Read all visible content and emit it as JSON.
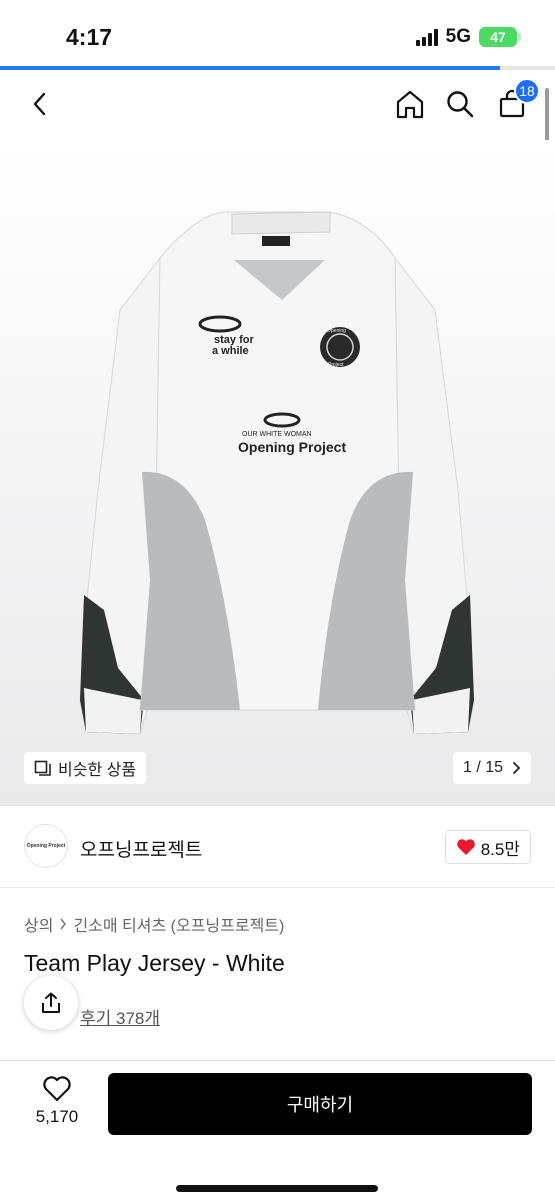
{
  "status_bar": {
    "time": "4:17",
    "network": "5G",
    "battery": "47"
  },
  "page_progress": 0.9,
  "header": {
    "cart_count": "18"
  },
  "gallery": {
    "similar_label": "비슷한 상품",
    "page_indicator": "1 / 15",
    "image_texts": {
      "chest_slogan_line1": "stay for",
      "chest_slogan_line2": "a while",
      "center_print": "Opening Project",
      "center_print_small": "OUR WHITE WOMAN",
      "badge_top": "Opening",
      "badge_bottom": "Project"
    }
  },
  "brand": {
    "logo_text": "Opening Project",
    "name": "오프닝프로젝트",
    "likes": "8.5만"
  },
  "breadcrumb": {
    "level1": "상의",
    "level2": "긴소매 티셔츠 (오프닝프로젝트)"
  },
  "product": {
    "title": "Team Play Jersey - White",
    "reviews_label": "후기 378개"
  },
  "bottom_bar": {
    "wishlist_count": "5,170",
    "buy_label": "구매하기"
  },
  "colors": {
    "accent": "#1c6ff0",
    "like_heart": "#e8192c",
    "buy_button": "#000000",
    "battery": "#4cd964"
  },
  "icons": [
    "back-arrow-icon",
    "home-icon",
    "search-icon",
    "cart-icon",
    "similar-items-icon",
    "chevron-right-icon",
    "heart-icon",
    "share-icon",
    "heart-outline-icon"
  ]
}
